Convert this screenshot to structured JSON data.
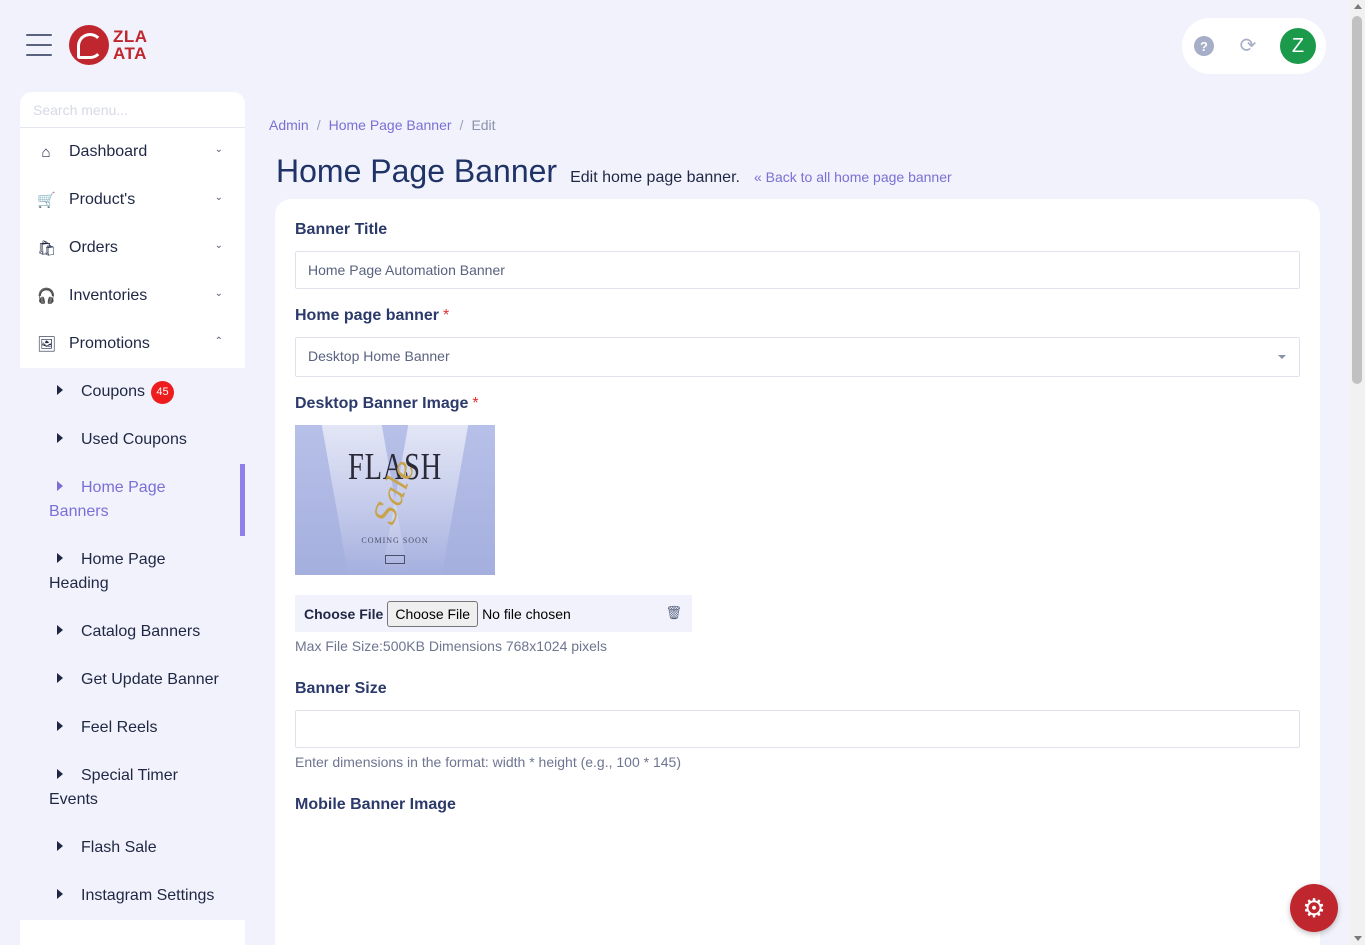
{
  "header": {
    "logo_line1": "ZLA",
    "logo_line2": "ATA",
    "help_icon": "?",
    "refresh_icon": "⟳",
    "avatar_initial": "Z"
  },
  "sidebar": {
    "search_placeholder": "Search menu...",
    "items": [
      {
        "label": "Dashboard",
        "icon": "home-icon",
        "glyph": "⌂",
        "expanded": false
      },
      {
        "label": "Product's",
        "icon": "cart-icon",
        "glyph": "🛒",
        "expanded": false
      },
      {
        "label": "Orders",
        "icon": "bag-icon",
        "glyph": "🛍",
        "expanded": false
      },
      {
        "label": "Inventories",
        "icon": "headset-icon",
        "glyph": "🎧",
        "expanded": false
      },
      {
        "label": "Promotions",
        "icon": "image-icon",
        "glyph": "🖼",
        "expanded": true
      }
    ],
    "chevron_down": "⌄",
    "chevron_up": "⌃",
    "promotions_sub": [
      {
        "label": "Coupons",
        "badge": "45",
        "active": false
      },
      {
        "label": "Used Coupons",
        "active": false
      },
      {
        "label": "Home Page Banners",
        "active": true
      },
      {
        "label": "Home Page Heading",
        "active": false
      },
      {
        "label": "Catalog Banners",
        "active": false
      },
      {
        "label": "Get Update Banner",
        "active": false
      },
      {
        "label": "Feel Reels",
        "active": false
      },
      {
        "label": "Special Timer Events",
        "active": false
      },
      {
        "label": "Flash Sale",
        "active": false
      },
      {
        "label": "Instagram Settings",
        "active": false
      }
    ]
  },
  "breadcrumb": {
    "items": [
      "Admin",
      "Home Page Banner",
      "Edit"
    ],
    "separator": "/"
  },
  "page": {
    "title": "Home Page Banner",
    "subtitle": "Edit home page banner.",
    "back_link": "« Back to all home page banner"
  },
  "form": {
    "banner_title_label": "Banner Title",
    "banner_title_value": "Home Page Automation Banner",
    "home_banner_label": "Home page banner",
    "required_mark": "*",
    "home_banner_value": "Desktop Home Banner",
    "desktop_image_label": "Desktop Banner Image",
    "image_text_flash": "FLASH",
    "image_text_sale": "Sale",
    "image_text_soon": "COMING SOON",
    "file_label": "Choose File",
    "file_button": "Choose File",
    "file_status": "No file chosen",
    "trash_icon": "🗑",
    "file_help": "Max File Size:500KB Dimensions 768x1024 pixels",
    "banner_size_label": "Banner Size",
    "banner_size_value": "",
    "banner_size_help": "Enter dimensions in the format: width * height (e.g., 100 * 145)",
    "mobile_image_label": "Mobile Banner Image"
  },
  "fab": {
    "icon": "⚙"
  },
  "colors": {
    "accent": "#7b6fd6",
    "brand": "#c0262d",
    "avatar": "#1a9a4a",
    "badge": "#ee1c1c",
    "background": "#f1f2fb"
  }
}
